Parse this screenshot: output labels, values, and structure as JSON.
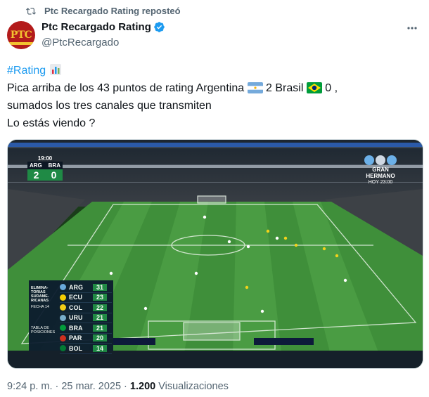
{
  "repost": {
    "text": "Ptc Recargado Rating reposteó"
  },
  "author": {
    "name": "Ptc Recargado Rating",
    "handle": "@PtcRecargado",
    "avatar_text": "PTC"
  },
  "tweet": {
    "hashtag": "#Rating",
    "line1a": "Pica arriba de los 43 puntos de rating Argentina",
    "line1b": "2 Brasil",
    "line1c": "0 ,",
    "line2": "sumados los tres canales que transmiten",
    "line3": "Lo estás viendo ?"
  },
  "media": {
    "clock": "19:00",
    "score_home": "ARG",
    "score_away": "BRA",
    "goals_home": "2",
    "goals_away": "0",
    "promo_line1": "GRAN",
    "promo_line2": "HERMANO",
    "promo_line3": "HOY 23:00",
    "table_title1": "ELIMINA-",
    "table_title2": "TORIAS",
    "table_title3": "SUDAME-",
    "table_title4": "RICANAS",
    "table_sub": "FECHA 14",
    "table_label1": "TABLA DE",
    "table_label2": "POSICIONES",
    "standings": [
      {
        "team": "ARG",
        "pts": "31",
        "color": "#6cace4"
      },
      {
        "team": "ECU",
        "pts": "23",
        "color": "#ffd100"
      },
      {
        "team": "COL",
        "pts": "22",
        "color": "#fcd116"
      },
      {
        "team": "URU",
        "pts": "21",
        "color": "#7bafd4"
      },
      {
        "team": "BRA",
        "pts": "21",
        "color": "#009c3b"
      },
      {
        "team": "PAR",
        "pts": "20",
        "color": "#d52b1e"
      },
      {
        "team": "BOL",
        "pts": "14",
        "color": "#007934"
      }
    ]
  },
  "footer": {
    "time": "9:24 p. m. · 25 mar. 2025 ·",
    "views_count": "1.200",
    "views_label": "Visualizaciones"
  },
  "colors": {
    "accent": "#1d9bf0",
    "muted": "#536471"
  }
}
